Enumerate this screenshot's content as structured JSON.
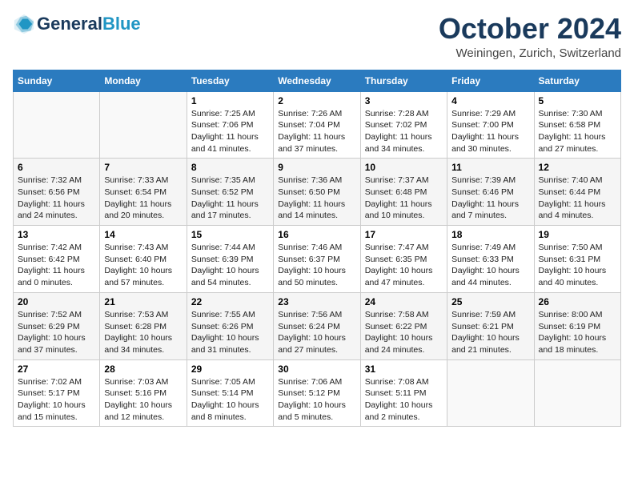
{
  "header": {
    "logo_line1": "General",
    "logo_line2": "Blue",
    "month_title": "October 2024",
    "location": "Weiningen, Zurich, Switzerland"
  },
  "weekdays": [
    "Sunday",
    "Monday",
    "Tuesday",
    "Wednesday",
    "Thursday",
    "Friday",
    "Saturday"
  ],
  "weeks": [
    [
      {
        "day": "",
        "info": ""
      },
      {
        "day": "",
        "info": ""
      },
      {
        "day": "1",
        "info": "Sunrise: 7:25 AM\nSunset: 7:06 PM\nDaylight: 11 hours and 41 minutes."
      },
      {
        "day": "2",
        "info": "Sunrise: 7:26 AM\nSunset: 7:04 PM\nDaylight: 11 hours and 37 minutes."
      },
      {
        "day": "3",
        "info": "Sunrise: 7:28 AM\nSunset: 7:02 PM\nDaylight: 11 hours and 34 minutes."
      },
      {
        "day": "4",
        "info": "Sunrise: 7:29 AM\nSunset: 7:00 PM\nDaylight: 11 hours and 30 minutes."
      },
      {
        "day": "5",
        "info": "Sunrise: 7:30 AM\nSunset: 6:58 PM\nDaylight: 11 hours and 27 minutes."
      }
    ],
    [
      {
        "day": "6",
        "info": "Sunrise: 7:32 AM\nSunset: 6:56 PM\nDaylight: 11 hours and 24 minutes."
      },
      {
        "day": "7",
        "info": "Sunrise: 7:33 AM\nSunset: 6:54 PM\nDaylight: 11 hours and 20 minutes."
      },
      {
        "day": "8",
        "info": "Sunrise: 7:35 AM\nSunset: 6:52 PM\nDaylight: 11 hours and 17 minutes."
      },
      {
        "day": "9",
        "info": "Sunrise: 7:36 AM\nSunset: 6:50 PM\nDaylight: 11 hours and 14 minutes."
      },
      {
        "day": "10",
        "info": "Sunrise: 7:37 AM\nSunset: 6:48 PM\nDaylight: 11 hours and 10 minutes."
      },
      {
        "day": "11",
        "info": "Sunrise: 7:39 AM\nSunset: 6:46 PM\nDaylight: 11 hours and 7 minutes."
      },
      {
        "day": "12",
        "info": "Sunrise: 7:40 AM\nSunset: 6:44 PM\nDaylight: 11 hours and 4 minutes."
      }
    ],
    [
      {
        "day": "13",
        "info": "Sunrise: 7:42 AM\nSunset: 6:42 PM\nDaylight: 11 hours and 0 minutes."
      },
      {
        "day": "14",
        "info": "Sunrise: 7:43 AM\nSunset: 6:40 PM\nDaylight: 10 hours and 57 minutes."
      },
      {
        "day": "15",
        "info": "Sunrise: 7:44 AM\nSunset: 6:39 PM\nDaylight: 10 hours and 54 minutes."
      },
      {
        "day": "16",
        "info": "Sunrise: 7:46 AM\nSunset: 6:37 PM\nDaylight: 10 hours and 50 minutes."
      },
      {
        "day": "17",
        "info": "Sunrise: 7:47 AM\nSunset: 6:35 PM\nDaylight: 10 hours and 47 minutes."
      },
      {
        "day": "18",
        "info": "Sunrise: 7:49 AM\nSunset: 6:33 PM\nDaylight: 10 hours and 44 minutes."
      },
      {
        "day": "19",
        "info": "Sunrise: 7:50 AM\nSunset: 6:31 PM\nDaylight: 10 hours and 40 minutes."
      }
    ],
    [
      {
        "day": "20",
        "info": "Sunrise: 7:52 AM\nSunset: 6:29 PM\nDaylight: 10 hours and 37 minutes."
      },
      {
        "day": "21",
        "info": "Sunrise: 7:53 AM\nSunset: 6:28 PM\nDaylight: 10 hours and 34 minutes."
      },
      {
        "day": "22",
        "info": "Sunrise: 7:55 AM\nSunset: 6:26 PM\nDaylight: 10 hours and 31 minutes."
      },
      {
        "day": "23",
        "info": "Sunrise: 7:56 AM\nSunset: 6:24 PM\nDaylight: 10 hours and 27 minutes."
      },
      {
        "day": "24",
        "info": "Sunrise: 7:58 AM\nSunset: 6:22 PM\nDaylight: 10 hours and 24 minutes."
      },
      {
        "day": "25",
        "info": "Sunrise: 7:59 AM\nSunset: 6:21 PM\nDaylight: 10 hours and 21 minutes."
      },
      {
        "day": "26",
        "info": "Sunrise: 8:00 AM\nSunset: 6:19 PM\nDaylight: 10 hours and 18 minutes."
      }
    ],
    [
      {
        "day": "27",
        "info": "Sunrise: 7:02 AM\nSunset: 5:17 PM\nDaylight: 10 hours and 15 minutes."
      },
      {
        "day": "28",
        "info": "Sunrise: 7:03 AM\nSunset: 5:16 PM\nDaylight: 10 hours and 12 minutes."
      },
      {
        "day": "29",
        "info": "Sunrise: 7:05 AM\nSunset: 5:14 PM\nDaylight: 10 hours and 8 minutes."
      },
      {
        "day": "30",
        "info": "Sunrise: 7:06 AM\nSunset: 5:12 PM\nDaylight: 10 hours and 5 minutes."
      },
      {
        "day": "31",
        "info": "Sunrise: 7:08 AM\nSunset: 5:11 PM\nDaylight: 10 hours and 2 minutes."
      },
      {
        "day": "",
        "info": ""
      },
      {
        "day": "",
        "info": ""
      }
    ]
  ]
}
